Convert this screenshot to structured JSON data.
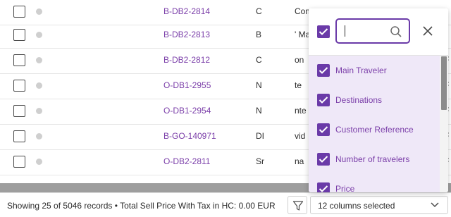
{
  "table": {
    "rows": [
      {
        "ref": "B-DB2-2814",
        "c4": "C",
        "c5": "Com",
        "c6": ""
      },
      {
        "ref": "B-DB2-2813",
        "c4": "B",
        "c5": "' Ma",
        "c6": ""
      },
      {
        "ref": "B-DB2-2812",
        "c4": "C",
        "c5": "on",
        "c6": "F"
      },
      {
        "ref": "O-DB1-2955",
        "c4": "N",
        "c5": "te",
        "c6": "F"
      },
      {
        "ref": "O-DB1-2954",
        "c4": "N",
        "c5": "nte",
        "c6": "F"
      },
      {
        "ref": "B-GO-140971",
        "c4": "DI",
        "c5": "vid",
        "c6": "F"
      },
      {
        "ref": "O-DB2-2811",
        "c4": "Sr",
        "c5": "na",
        "c6": "F"
      }
    ]
  },
  "footer": {
    "summary": "Showing 25 of 5046 records • Total Sell Price With Tax in HC: 0.00 EUR",
    "columns_selected": "12 columns selected"
  },
  "column_picker": {
    "search_value": "",
    "items": [
      {
        "label": "Main Traveler",
        "checked": true
      },
      {
        "label": "Destinations",
        "checked": true
      },
      {
        "label": "Customer Reference",
        "checked": true
      },
      {
        "label": "Number of travelers",
        "checked": true
      },
      {
        "label": "Price",
        "checked": true
      }
    ]
  },
  "colors": {
    "accent": "#6a3aa8",
    "link": "#7b3fa9",
    "list_bg": "#efe8f8"
  }
}
